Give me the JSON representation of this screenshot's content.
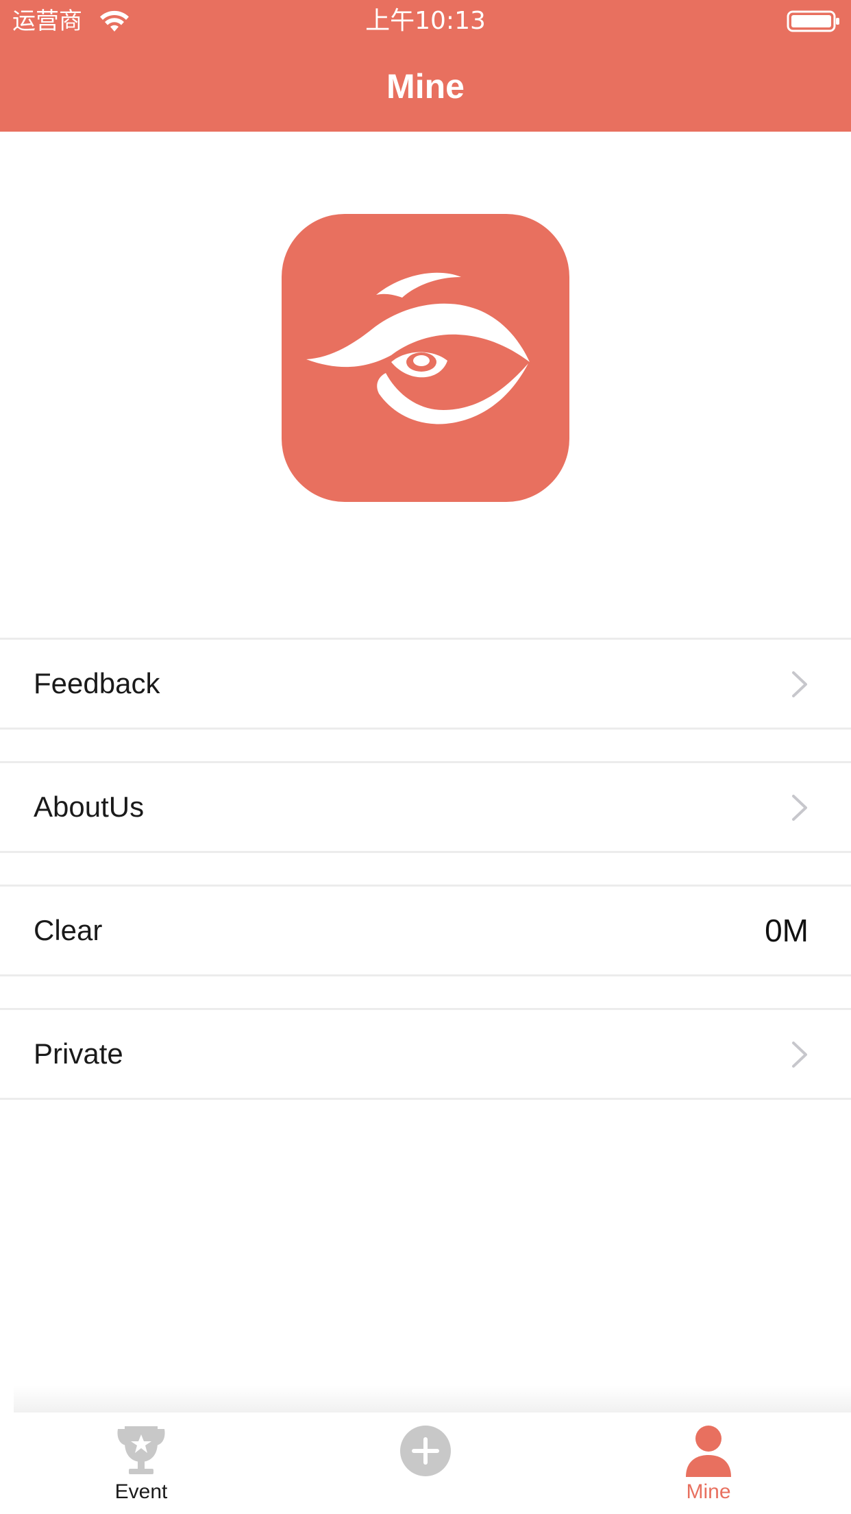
{
  "status_bar": {
    "carrier": "运营商",
    "time": "上午10:13"
  },
  "nav": {
    "title": "Mine"
  },
  "menu": {
    "items": [
      {
        "label": "Feedback",
        "icon": "chevron-right-icon"
      },
      {
        "label": "AboutUs",
        "icon": "chevron-right-icon"
      },
      {
        "label": "Clear",
        "value": "0M"
      },
      {
        "label": "Private",
        "icon": "chevron-right-icon"
      }
    ]
  },
  "tabbar": {
    "tabs": [
      {
        "label": "Event",
        "icon": "trophy-icon",
        "selected": false
      },
      {
        "label": "",
        "icon": "plus-circle-icon",
        "selected": false
      },
      {
        "label": "Mine",
        "icon": "user-icon",
        "selected": true
      }
    ]
  },
  "colors": {
    "accent": "#E8705F",
    "inactive_icon": "#C8C8C8",
    "chevron": "#C7C7CC"
  }
}
